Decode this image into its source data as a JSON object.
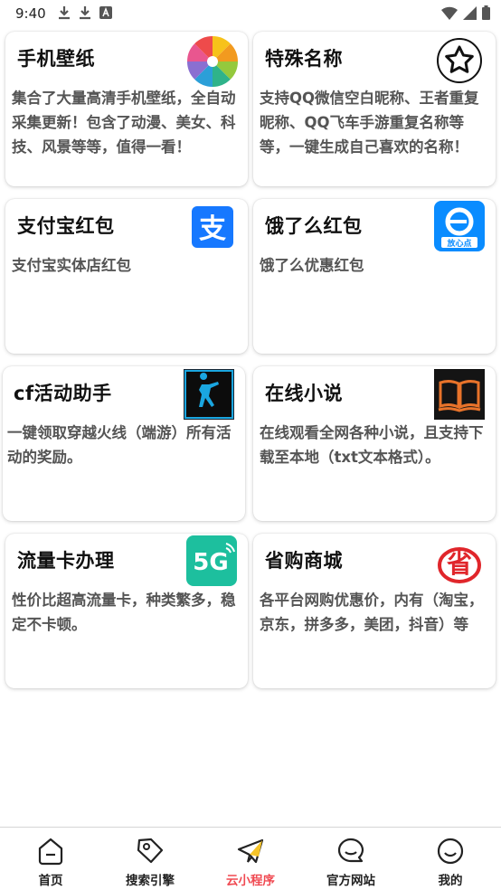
{
  "status_bar": {
    "time": "9:40"
  },
  "cards": [
    {
      "title": "手机壁纸",
      "desc": "集合了大量高清手机壁纸，全自动采集更新！包含了动漫、美女、科技、风景等等，值得一看！",
      "icon": "color-wheel-icon"
    },
    {
      "title": "特殊名称",
      "desc": "支持QQ微信空白昵称、王者重复昵称、QQ飞车手游重复名称等等，一键生成自己喜欢的名称！",
      "icon": "star-badge-icon"
    },
    {
      "title": "支付宝红包",
      "desc": "支付宝实体店红包",
      "icon": "alipay-icon"
    },
    {
      "title": "饿了么红包",
      "desc": "饿了么优惠红包",
      "icon": "eleme-icon",
      "icon_caption": "放心点"
    },
    {
      "title": "cf活动助手",
      "desc": "一键领取穿越火线（端游）所有活动的奖励。",
      "icon": "cf-soldier-icon"
    },
    {
      "title": "在线小说",
      "desc": "在线观看全网各种小说，且支持下载至本地（txt文本格式）。",
      "icon": "book-icon"
    },
    {
      "title": "流量卡办理",
      "desc": "性价比超高流量卡，种类繁多，稳定不卡顿。",
      "icon": "5g-icon",
      "icon_text": "5G"
    },
    {
      "title": "省购商城",
      "desc": "各平台网购优惠价，内有（淘宝，京东，拼多多，美团，抖音）等",
      "icon": "shenggou-logo-icon",
      "icon_text": "省"
    }
  ],
  "tabbar": {
    "items": [
      {
        "label": "首页",
        "icon": "home-icon"
      },
      {
        "label": "搜索引擎",
        "icon": "tag-icon"
      },
      {
        "label": "云小程序",
        "icon": "paper-plane-icon",
        "active": true
      },
      {
        "label": "官方网站",
        "icon": "chat-bubble-icon"
      },
      {
        "label": "我的",
        "icon": "smile-icon"
      }
    ]
  },
  "colors": {
    "accent": "#f04a52",
    "alipay": "#1678ff",
    "eleme": "#0a8cff",
    "fiveg": "#1dbf9e",
    "shenggou_red": "#e0262b"
  }
}
